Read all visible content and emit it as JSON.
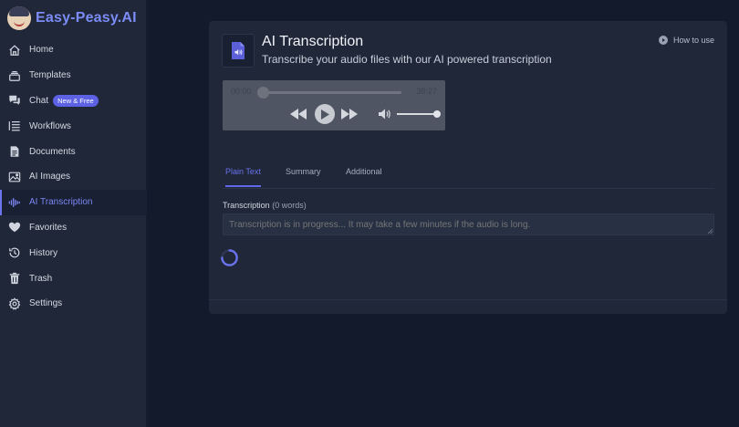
{
  "app": {
    "brand": "Easy-Peasy.AI"
  },
  "sidebar": {
    "items": [
      {
        "label": "Home",
        "icon": "home-icon"
      },
      {
        "label": "Templates",
        "icon": "layers-icon"
      },
      {
        "label": "Chat",
        "icon": "chat-icon",
        "badge": "New & Free"
      },
      {
        "label": "Workflows",
        "icon": "list-icon"
      },
      {
        "label": "Documents",
        "icon": "document-icon"
      },
      {
        "label": "AI Images",
        "icon": "image-icon"
      },
      {
        "label": "AI Transcription",
        "icon": "waveform-icon",
        "active": true
      },
      {
        "label": "Favorites",
        "icon": "heart-icon"
      },
      {
        "label": "History",
        "icon": "history-icon"
      },
      {
        "label": "Trash",
        "icon": "trash-icon"
      },
      {
        "label": "Settings",
        "icon": "gear-icon"
      }
    ]
  },
  "header": {
    "title": "AI Transcription",
    "subtitle": "Transcribe your audio files with our AI powered transcription",
    "how_to_use": "How to use"
  },
  "player": {
    "current_time": "00:00",
    "duration": "39:27",
    "progress": 0.0,
    "volume": 1.0
  },
  "tabs": [
    {
      "label": "Plain Text",
      "active": true
    },
    {
      "label": "Summary",
      "active": false
    },
    {
      "label": "Additional",
      "active": false
    }
  ],
  "transcription": {
    "label": "Transcription",
    "word_count": "(0 words)",
    "placeholder": "Transcription is in progress... It may take a few minutes if the audio is long."
  },
  "colors": {
    "accent": "#6a72ee",
    "background": "#131a2b",
    "panel": "#1f2738"
  }
}
